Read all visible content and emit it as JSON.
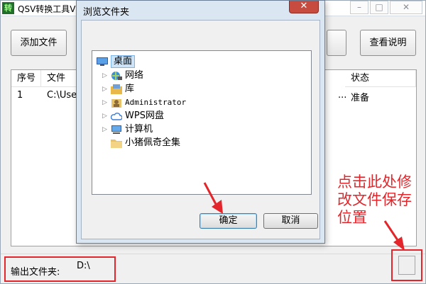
{
  "app": {
    "icon_text": "转",
    "title": "QSV转换工具V",
    "caption_min": "–",
    "caption_max": "□",
    "caption_close": "✕"
  },
  "toolbar": {
    "add_file_label": "添加文件",
    "help_label": "查看说明"
  },
  "file_list": {
    "columns": [
      "序号",
      "文件",
      "状态"
    ],
    "rows": [
      {
        "index": "1",
        "file": "C:\\User",
        "ellipsis": "...",
        "status": "准备"
      }
    ]
  },
  "bottom": {
    "output_label": "输出文件夹:",
    "output_path": "D:\\"
  },
  "annotation": {
    "text": "点击此处修改文件保存位置",
    "color": "#e2262b"
  },
  "dialog": {
    "title": "浏览文件夹",
    "close_glyph": "✕",
    "tree": [
      {
        "label": "桌面",
        "icon": "desktop-icon",
        "selected": true
      },
      {
        "label": "网络",
        "icon": "network-icon"
      },
      {
        "label": "库",
        "icon": "library-icon"
      },
      {
        "label": "Administrator",
        "icon": "user-folder-icon"
      },
      {
        "label": "WPS网盘",
        "icon": "cloud-drive-icon"
      },
      {
        "label": "计算机",
        "icon": "computer-icon"
      },
      {
        "label": "小猪佩奇全集",
        "icon": "folder-icon"
      }
    ],
    "ok_label": "确定",
    "cancel_label": "取消"
  },
  "colors": {
    "highlight_red": "#e2262b",
    "dialog_frame": "#dbe6f3",
    "selected_bg": "#cde3f7"
  }
}
